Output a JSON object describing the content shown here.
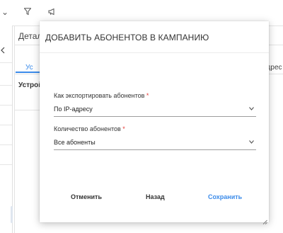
{
  "background": {
    "topbar": {
      "dropdown_icon": "chevron-down-icon",
      "filter_icon": "filter-icon",
      "megaphone_icon": "megaphone-icon"
    },
    "panel_title": "Детали",
    "tab_left": "Ус",
    "tab_right": "адрес",
    "cell_text": "Устройст"
  },
  "modal": {
    "title": "ДОБАВИТЬ АБОНЕНТОВ В КАМПАНИЮ",
    "fields": [
      {
        "label": "Как экспортировать абонентов",
        "required_mark": "*",
        "value": "По IP-адресу"
      },
      {
        "label": "Количество абонентов",
        "required_mark": "*",
        "value": "Все абоненты"
      }
    ],
    "buttons": {
      "cancel": "Отменить",
      "back": "Назад",
      "save": "Сохранить"
    }
  },
  "colors": {
    "accent": "#3b8bea",
    "required": "#e53935"
  }
}
